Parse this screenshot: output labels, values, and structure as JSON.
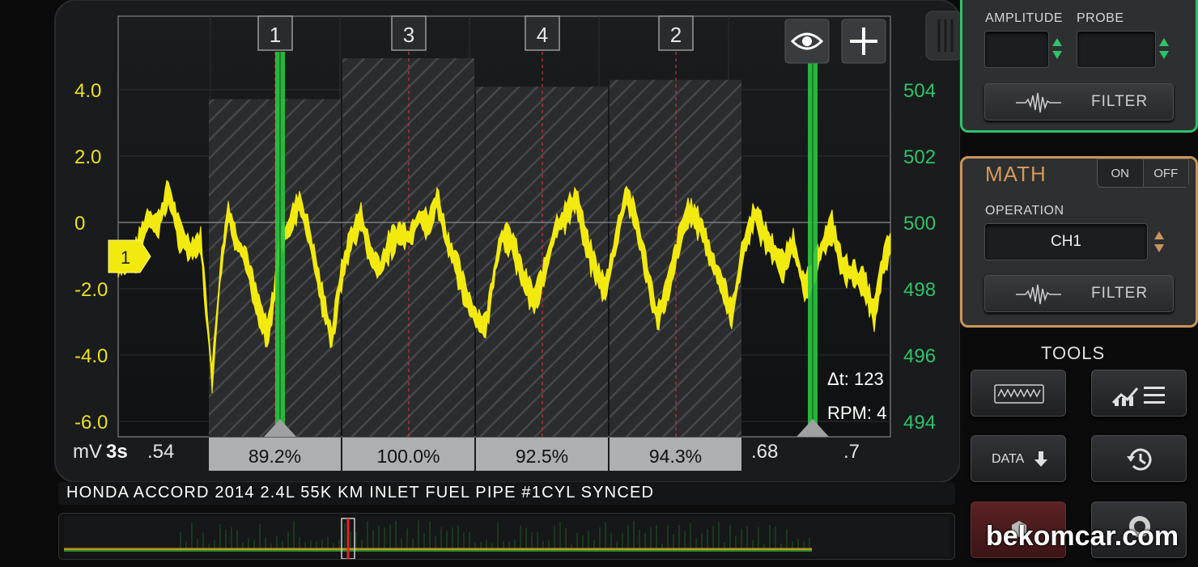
{
  "scope": {
    "y_left_ticks": [
      {
        "label": "4.0",
        "value": 4.0
      },
      {
        "label": "2.0",
        "value": 2.0
      },
      {
        "label": "0",
        "value": 0
      },
      {
        "label": "-2.0",
        "value": -2.0
      },
      {
        "label": "-4.0",
        "value": -4.0
      },
      {
        "label": "-6.0",
        "value": -6.0
      }
    ],
    "y_right_ticks": [
      {
        "label": "504",
        "value": 504
      },
      {
        "label": "502",
        "value": 502
      },
      {
        "label": "500",
        "value": 500
      },
      {
        "label": "498",
        "value": 498
      },
      {
        "label": "496",
        "value": 496
      },
      {
        "label": "494",
        "value": 494
      }
    ],
    "y_unit": "mV",
    "time_unit": "3s",
    "x_ticks": [
      ".54",
      ".68",
      ".7"
    ],
    "channel_marker": "1",
    "cylinders": [
      {
        "label": "1",
        "duty": "89.2%",
        "fraction": 0.892
      },
      {
        "label": "3",
        "duty": "100.0%",
        "fraction": 1.0
      },
      {
        "label": "4",
        "duty": "92.5%",
        "fraction": 0.925
      },
      {
        "label": "2",
        "duty": "94.3%",
        "fraction": 0.943
      }
    ],
    "delta_t": "Δt: 123",
    "rpm": "RPM: 4",
    "trace_color": "#f2ea0e",
    "cursor_color": "#27c840",
    "right_axis_color": "#2ec26a",
    "left_axis_color": "#e9e21d",
    "eye_icon": "eye-icon",
    "plus_icon": "plus-icon"
  },
  "channel_panel": {
    "amplitude_label": "AMPLITUDE",
    "probe_label": "PROBE",
    "amplitude_value": "",
    "probe_value": "",
    "filter_label": "FILTER",
    "border_color": "#2ec26a"
  },
  "math_panel": {
    "title": "MATH",
    "on_label": "ON",
    "off_label": "OFF",
    "operation_label": "OPERATION",
    "operation_value": "CH1",
    "filter_label": "FILTER",
    "border_color": "#c9955a"
  },
  "tools": {
    "title": "TOOLS",
    "data_label": "DATA"
  },
  "footer": {
    "title": "HONDA ACCORD 2014 2.4L 55K KM INLET FUEL PIPE #1CYL SYNCED"
  },
  "watermark": "bekomcar.com"
}
